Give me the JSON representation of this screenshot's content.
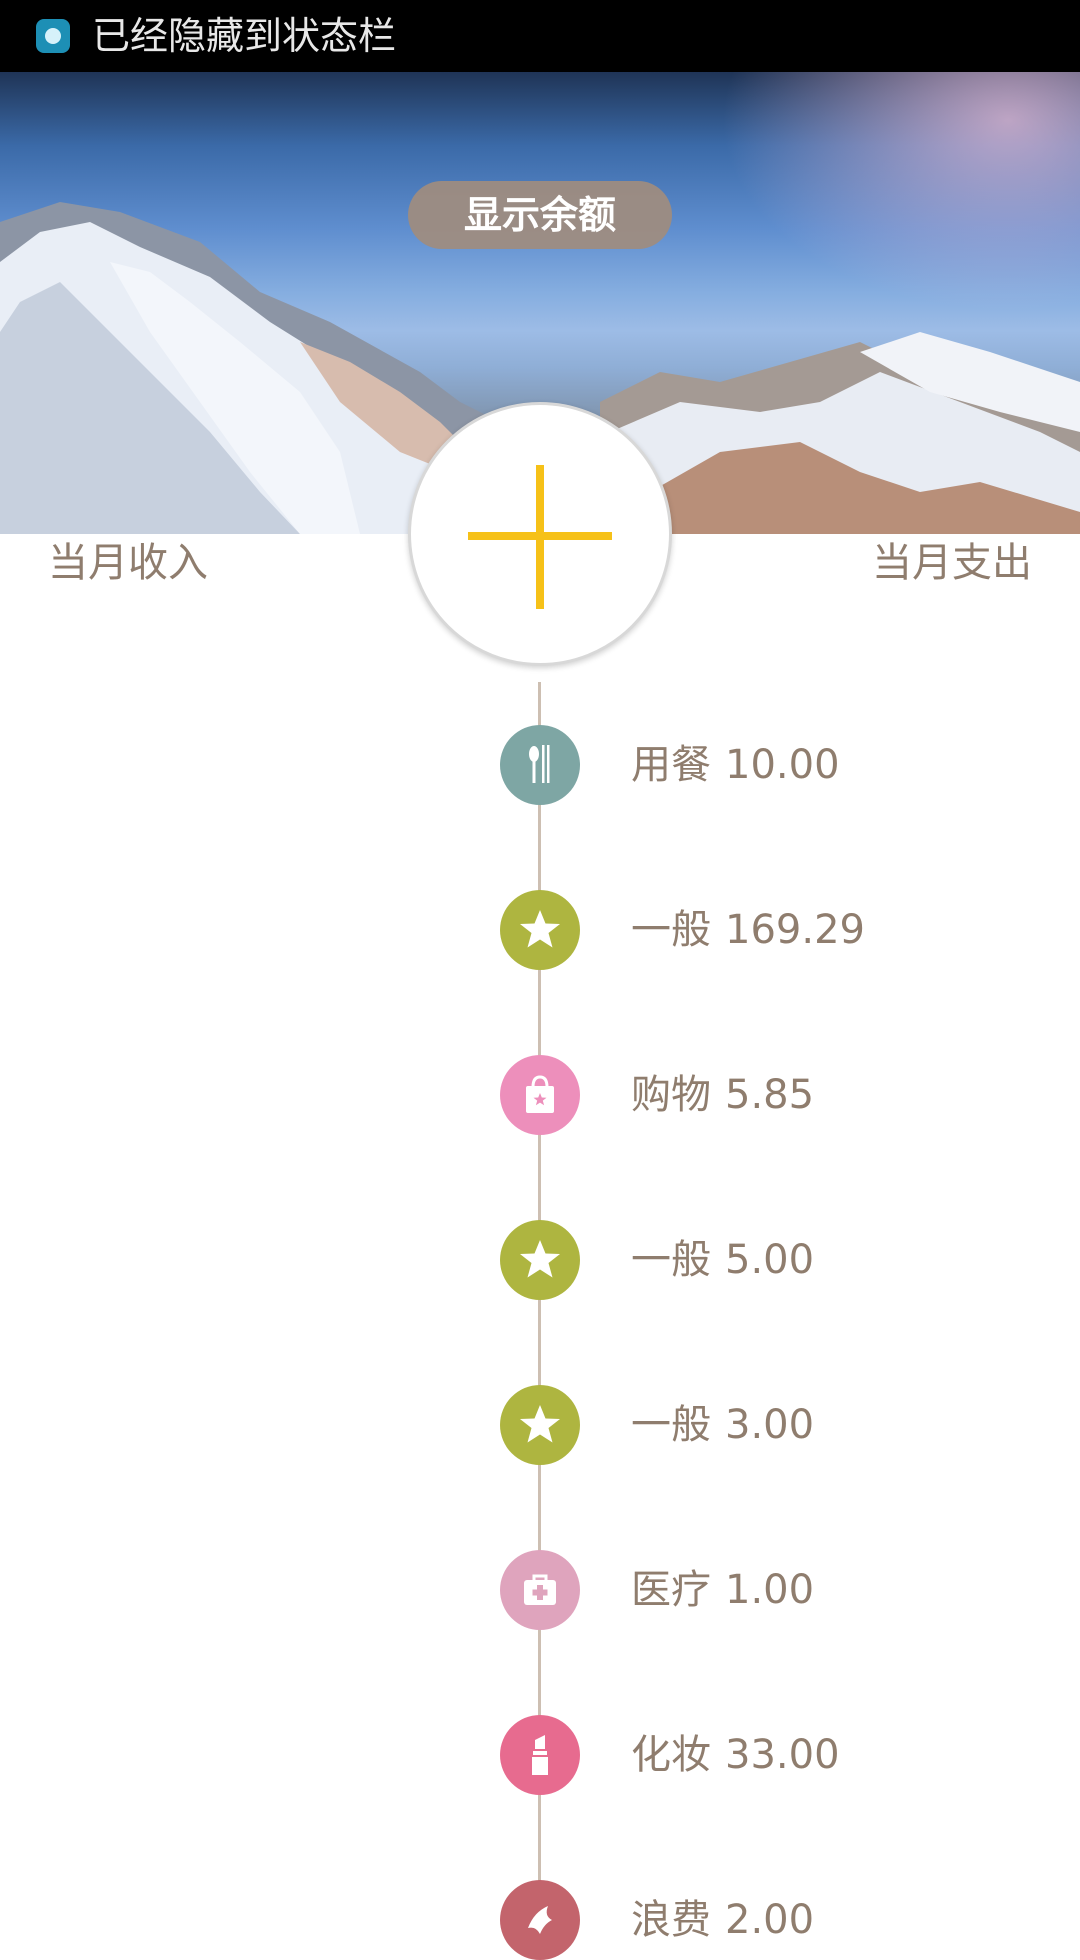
{
  "status_bar": {
    "text": "已经隐藏到状态栏",
    "icon": "app-notification-icon"
  },
  "header": {
    "balance_button": "显示余额"
  },
  "summary": {
    "income_label": "当月收入",
    "expense_label": "当月支出"
  },
  "add_button": {
    "icon": "plus-icon",
    "color": "#f6c118"
  },
  "entries": [
    {
      "category": "用餐",
      "amount": "10.00",
      "icon": "dining-icon",
      "color": "#7ea6a4"
    },
    {
      "category": "一般",
      "amount": "169.29",
      "icon": "star-icon",
      "color": "#aeb540"
    },
    {
      "category": "购物",
      "amount": "5.85",
      "icon": "shopping-bag-icon",
      "color": "#ed8fbb"
    },
    {
      "category": "一般",
      "amount": "5.00",
      "icon": "star-icon",
      "color": "#aeb540"
    },
    {
      "category": "一般",
      "amount": "3.00",
      "icon": "star-icon",
      "color": "#aeb540"
    },
    {
      "category": "医疗",
      "amount": "1.00",
      "icon": "medical-kit-icon",
      "color": "#dfa4bd"
    },
    {
      "category": "化妆",
      "amount": "33.00",
      "icon": "lipstick-icon",
      "color": "#e76b8f"
    },
    {
      "category": "浪费",
      "amount": "2.00",
      "icon": "waste-icon",
      "color": "#c3646c"
    }
  ]
}
